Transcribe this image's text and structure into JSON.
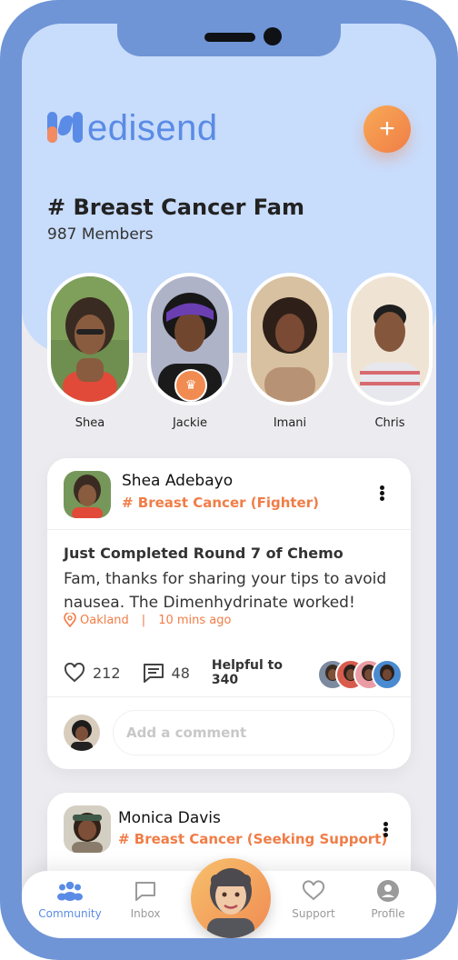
{
  "app": {
    "brand_name": "edisend",
    "add_button_label": "+"
  },
  "group": {
    "title": "# Breast Cancer Fam",
    "members": "987 Members"
  },
  "stories": [
    {
      "name": "Shea",
      "crown": false
    },
    {
      "name": "Jackie",
      "crown": true
    },
    {
      "name": "Imani",
      "crown": false
    },
    {
      "name": "Chris",
      "crown": false
    }
  ],
  "posts": [
    {
      "author": "Shea Adebayo",
      "tag": "# Breast Cancer (Fighter)",
      "title": "Just Completed  Round 7 of Chemo",
      "body": "Fam, thanks for sharing your tips to avoid nausea. The Dimenhydrinate worked!",
      "location": "Oakland",
      "time": "10 mins ago",
      "likes": "212",
      "comments": "48",
      "helpful": "Helpful to 340",
      "comment_placeholder": "Add a comment"
    },
    {
      "author": "Monica Davis",
      "tag": "# Breast Cancer (Seeking Support)"
    }
  ],
  "tabs": [
    {
      "label": "Community",
      "active": true
    },
    {
      "label": "Inbox",
      "active": false
    },
    {
      "label": "Support",
      "active": false
    },
    {
      "label": "Profile",
      "active": false
    }
  ],
  "colors": {
    "accent_blue": "#5a8be6",
    "accent_orange": "#f07d47",
    "hero_background": "#c8dcfb",
    "phone_frame": "#6f95d6"
  }
}
